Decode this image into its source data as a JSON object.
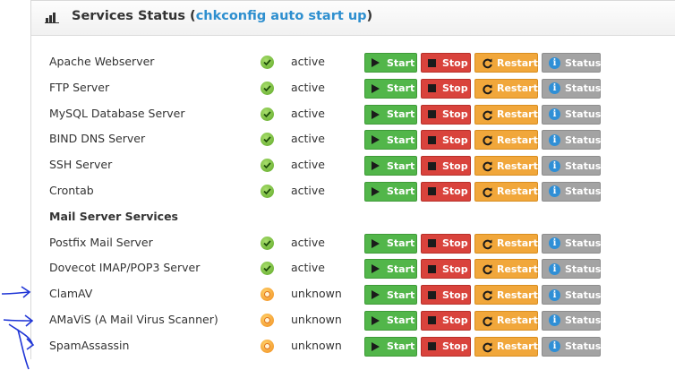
{
  "header": {
    "title_prefix": "Services Status (",
    "title_accent": "chkconfig auto start up",
    "title_suffix": ")"
  },
  "buttons": {
    "start": "Start",
    "stop": "Stop",
    "restart": "Restart",
    "status": "Status"
  },
  "rows": [
    {
      "type": "service",
      "name": "Apache Webserver",
      "state": "active",
      "icon": "check-circle-icon"
    },
    {
      "type": "service",
      "name": "FTP Server",
      "state": "active",
      "icon": "check-circle-icon"
    },
    {
      "type": "service",
      "name": "MySQL Database Server",
      "state": "active",
      "icon": "check-circle-icon"
    },
    {
      "type": "service",
      "name": "BIND DNS Server",
      "state": "active",
      "icon": "check-circle-icon"
    },
    {
      "type": "service",
      "name": "SSH Server",
      "state": "active",
      "icon": "check-circle-icon"
    },
    {
      "type": "service",
      "name": "Crontab",
      "state": "active",
      "icon": "check-circle-icon"
    },
    {
      "type": "section",
      "name": "Mail Server Services"
    },
    {
      "type": "service",
      "name": "Postfix Mail Server",
      "state": "active",
      "icon": "check-circle-icon"
    },
    {
      "type": "service",
      "name": "Dovecot IMAP/POP3 Server",
      "state": "active",
      "icon": "check-circle-icon"
    },
    {
      "type": "service",
      "name": "ClamAV",
      "state": "unknown",
      "icon": "unknown-circle-icon"
    },
    {
      "type": "service",
      "name": "AMaViS (A Mail Virus Scanner)",
      "state": "unknown",
      "icon": "unknown-circle-icon"
    },
    {
      "type": "service",
      "name": "SpamAssassin",
      "state": "unknown",
      "icon": "unknown-circle-icon"
    }
  ],
  "colors": {
    "accent": "#2e8fcf",
    "start": "#52b64a",
    "stop": "#d9433c",
    "restart": "#f1a73b",
    "status": "#a3a3a3",
    "annotation": "#1f35d6"
  }
}
